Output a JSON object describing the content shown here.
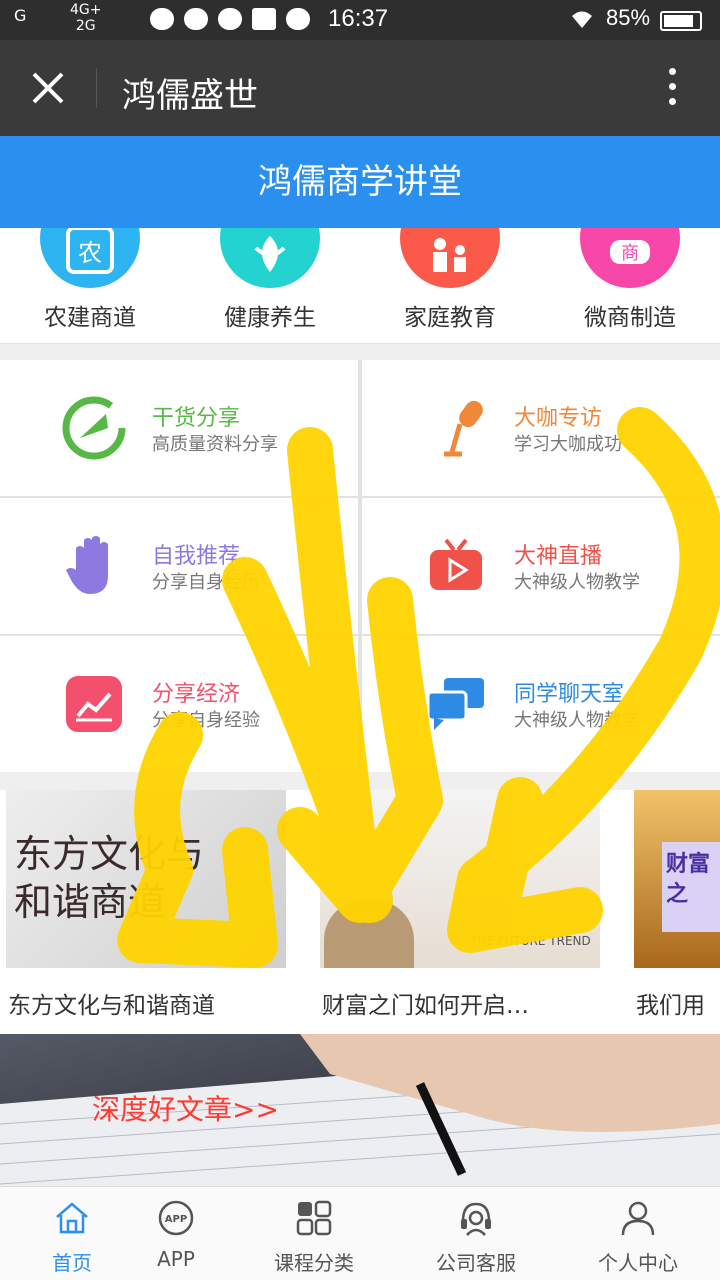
{
  "status_bar": {
    "carrier": "G",
    "network_top": "4G+",
    "network_bottom": "2G",
    "time": "16:37",
    "battery": "85%",
    "battery_level": 0.85
  },
  "titlebar": {
    "title": "鸿儒盛世",
    "close_icon": "close-icon",
    "more_icon": "more-vertical-icon"
  },
  "header": {
    "title": "鸿儒商学讲堂"
  },
  "categories": [
    {
      "label": "农建商道",
      "color": "#2fb4f2"
    },
    {
      "label": "健康养生",
      "color": "#22d3d0"
    },
    {
      "label": "家庭教育",
      "color": "#fb5a4a"
    },
    {
      "label": "微商制造",
      "color": "#f747a8"
    }
  ],
  "grid": [
    {
      "title": "干货分享",
      "subtitle": "高质量资料分享",
      "color": "#58b847"
    },
    {
      "title": "大咖专访",
      "subtitle": "学习大咖成功",
      "color": "#f0883a"
    },
    {
      "title": "自我推荐",
      "subtitle": "分享自身经历",
      "color": "#8d79e0"
    },
    {
      "title": "大神直播",
      "subtitle": "大神级人物教学",
      "color": "#f0524a"
    },
    {
      "title": "分享经济",
      "subtitle": "分享自身经验",
      "color": "#f2506c"
    },
    {
      "title": "同学聊天室",
      "subtitle": "大神级人物教学",
      "color": "#2d8be5"
    }
  ],
  "courses": [
    {
      "title": "东方文化与和谐商道",
      "thumb_text": "东方文化与和谐商道"
    },
    {
      "title": "财富之门如何开启…",
      "thumb_text": "THE FUTURE TREND"
    },
    {
      "title": "我们用",
      "thumb_text": "财富之"
    }
  ],
  "banner": {
    "text": "深度好文章>>"
  },
  "bottom_nav": [
    {
      "label": "首页",
      "icon": "home-icon",
      "active": true
    },
    {
      "label": "APP",
      "icon": "app-icon",
      "active": false
    },
    {
      "label": "课程分类",
      "icon": "grid-icon",
      "active": false
    },
    {
      "label": "公司客服",
      "icon": "headset-icon",
      "active": false
    },
    {
      "label": "个人中心",
      "icon": "user-icon",
      "active": false
    }
  ],
  "colors": {
    "primary": "#2b8fef",
    "statusbar": "#2e2e2e",
    "titlebar": "#3a3a3a",
    "doodle": "#ffd400"
  }
}
